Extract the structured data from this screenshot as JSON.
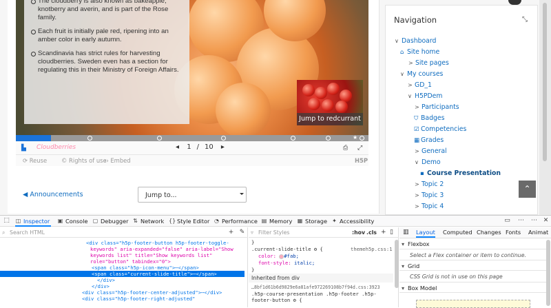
{
  "slide": {
    "bullets": [
      "The cloudberry is also known as bakeapple, knotberry and averin, and is part of the Rose family.",
      "Each fruit is initially pale red, ripening into an amber color in early autumn.",
      "Scandinavia has strict rules for harvesting cloudberries. Sweden even has a section for regulating this in their Ministry of Foreign Affairs."
    ],
    "jump_label": "Jump to redcurrant"
  },
  "footer": {
    "keyword": "Cloudberries",
    "current_page": "1",
    "separator": "/",
    "total_pages": "10",
    "prev_arrow": "◂",
    "next_arrow": "▸",
    "progress_fraction": 0.1
  },
  "actions": {
    "reuse": "Reuse",
    "rights": "Rights of use",
    "embed": "Embed",
    "h5p": "H5P"
  },
  "announcements_link": "◀ Announcements",
  "jump_select": {
    "value": "Jump to..."
  },
  "navigation": {
    "title": "Navigation",
    "items": [
      {
        "label": "Dashboard",
        "arrow": "∨"
      },
      {
        "label": "Site home",
        "icon": "home-icon"
      },
      {
        "label": "Site pages",
        "arrow": ">"
      },
      {
        "label": "My courses",
        "arrow": "∨"
      },
      {
        "label": "GD_1",
        "arrow": ">"
      },
      {
        "label": "H5PDem",
        "arrow": "∨"
      },
      {
        "label": "Participants",
        "arrow": ">"
      },
      {
        "label": "Badges",
        "icon": "shield-icon"
      },
      {
        "label": "Competencies",
        "icon": "checkbox-icon"
      },
      {
        "label": "Grades",
        "icon": "table-icon"
      },
      {
        "label": "General",
        "arrow": ">"
      },
      {
        "label": "Demo",
        "arrow": "∨"
      },
      {
        "label": "Course Presentation",
        "icon": "h5p-icon"
      },
      {
        "label": "Topic 2",
        "arrow": ">"
      },
      {
        "label": "Topic 3",
        "arrow": ">"
      },
      {
        "label": "Topic 4",
        "arrow": ">"
      }
    ]
  },
  "devtools": {
    "tabs": [
      "Inspector",
      "Console",
      "Debugger",
      "Network",
      "Style Editor",
      "Performance",
      "Memory",
      "Storage",
      "Accessibility"
    ],
    "search_placeholder": "Search HTML",
    "filter_placeholder": "Filter Styles",
    "hov": ":hov",
    "cls": ".cls",
    "html_lines": [
      "<div class=\"h5p-footer-button h5p-footer-toggle-",
      "keywords\" aria-expanded=\"false\" aria-label=\"Show",
      "keywords list\" title=\"Show keywords list\"",
      "role=\"button\" tabindex=\"0\">",
      "<span class=\"h5p-icon-menu\">⋯</span>",
      "<span class=\"current-slide-title\">⋯</span>",
      "</div>",
      "</div>",
      "<div class=\"h5p-footer-center-adjusted\">⋯</div>",
      "<div class=\"h5p-footer-right-adjusted\""
    ],
    "rules": {
      "brace_close": "}",
      "selector": ".current-slide-title",
      "source": "themeh5p.css:1",
      "color_prop": "color:",
      "color_val": "#fab;",
      "style_prop": "font-style:",
      "style_val": "italic;",
      "inherited": "Inherited from div",
      "inherited_source": "…8bf1d61b6d9829e6a81afe972269108b7f94d.css:3923",
      "inherited_sel": ".h5p-course-presentation .h5p-footer .h5p-",
      "inherited_sel2": "footer-button",
      "accent_color": "#ffaabb"
    },
    "layout_tabs": [
      "Layout",
      "Computed",
      "Changes",
      "Fonts",
      "Animat"
    ],
    "flexbox": "Flexbox",
    "flexbox_note": "Select a Flex container or item to continue.",
    "grid": "Grid",
    "grid_note": "CSS Grid is not in use on this page",
    "boxmodel": "Box Model"
  }
}
